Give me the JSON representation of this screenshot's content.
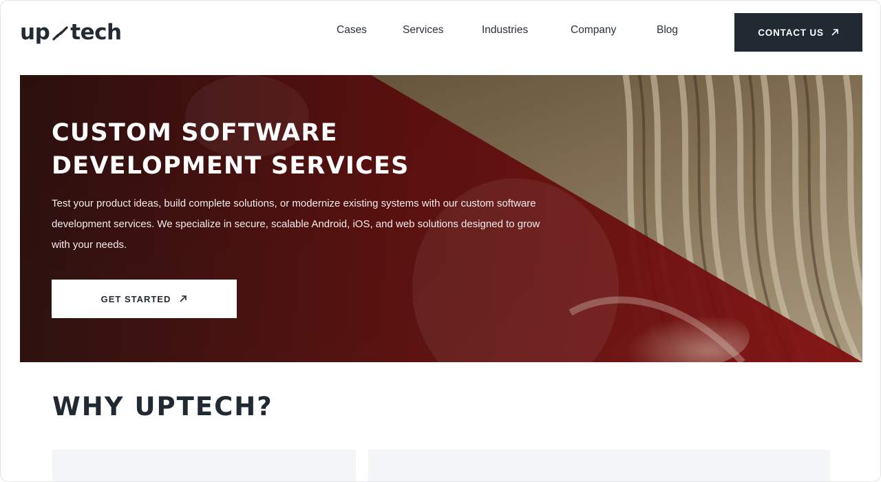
{
  "header": {
    "logo_left": "up",
    "logo_right": "tech",
    "nav": [
      {
        "label": "Cases"
      },
      {
        "label": "Services"
      },
      {
        "label": "Industries"
      },
      {
        "label": "Company"
      },
      {
        "label": "Blog"
      }
    ],
    "contact_label": "CONTACT US"
  },
  "hero": {
    "title_line1": "CUSTOM SOFTWARE",
    "title_line2": "DEVELOPMENT SERVICES",
    "description": "Test your product ideas, build complete solutions, or modernize existing systems with our custom software development services. We specialize in secure, scalable Android, iOS, and web solutions designed to grow with your needs.",
    "cta_label": "GET STARTED"
  },
  "why": {
    "title": "WHY UPTECH?"
  },
  "icons": {
    "arrow": "arrow-up-right-icon",
    "logo_mark": "dna-helix-icon"
  },
  "colors": {
    "dark": "#212a33",
    "hero_red": "#7a0f0f",
    "accent_green": "#2fb58a",
    "card_bg": "#f4f5f7"
  }
}
